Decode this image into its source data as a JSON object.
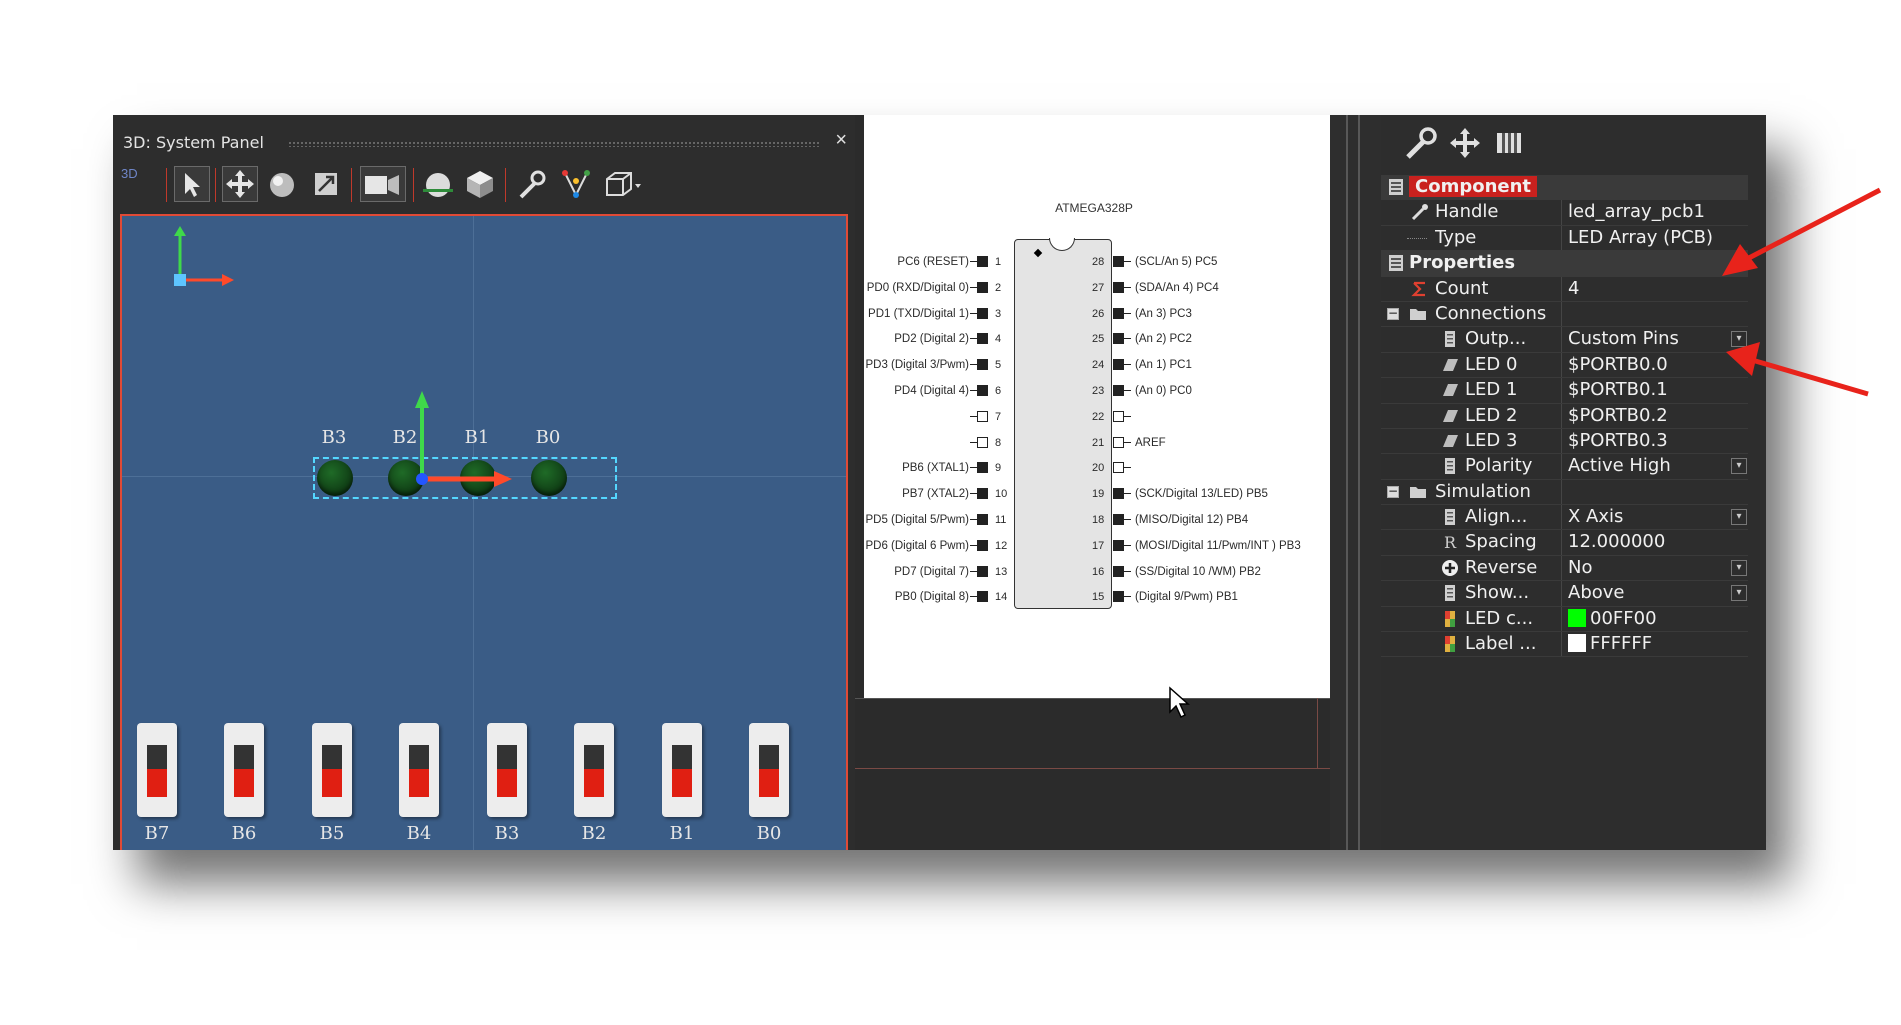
{
  "system_panel": {
    "title": "3D: System Panel",
    "close": "×",
    "toolbar": {
      "mode_label": "3D",
      "icons": [
        "pointer-icon",
        "move-icon",
        "sphere-icon",
        "resize-icon",
        "camera-icon",
        "light-sphere-icon",
        "cube-icon",
        "wrench-icon",
        "network-icon",
        "box-icon"
      ]
    },
    "led_labels": [
      "B3",
      "B2",
      "B1",
      "B0"
    ],
    "switch_labels": [
      "B7",
      "B6",
      "B5",
      "B4",
      "B3",
      "B2",
      "B1",
      "B0"
    ],
    "colors": {
      "viewport": "#3a5c86",
      "led": "#1f6b27",
      "switch_knob": "#e01f12"
    }
  },
  "schematic": {
    "chip_name": "ATMEGA328P",
    "left_pins": [
      {
        "num": "1",
        "label": "PC6 (RESET)"
      },
      {
        "num": "2",
        "label": "PD0 (RXD/Digital 0)"
      },
      {
        "num": "3",
        "label": "PD1 (TXD/Digital 1)"
      },
      {
        "num": "4",
        "label": "PD2 (Digital 2)"
      },
      {
        "num": "5",
        "label": "PD3 (Digital 3/Pwm)"
      },
      {
        "num": "6",
        "label": "PD4 (Digital 4)"
      },
      {
        "num": "7",
        "label": ""
      },
      {
        "num": "8",
        "label": ""
      },
      {
        "num": "9",
        "label": "PB6 (XTAL1)"
      },
      {
        "num": "10",
        "label": "PB7 (XTAL2)"
      },
      {
        "num": "11",
        "label": "PD5 (Digital 5/Pwm)"
      },
      {
        "num": "12",
        "label": "PD6 (Digital 6 Pwm)"
      },
      {
        "num": "13",
        "label": "PD7 (Digital 7)"
      },
      {
        "num": "14",
        "label": "PB0 (Digital 8)"
      }
    ],
    "right_pins": [
      {
        "num": "28",
        "label": "(SCL/An 5) PC5"
      },
      {
        "num": "27",
        "label": "(SDA/An 4) PC4"
      },
      {
        "num": "26",
        "label": "(An 3) PC3"
      },
      {
        "num": "25",
        "label": "(An 2) PC2"
      },
      {
        "num": "24",
        "label": "(An 1) PC1"
      },
      {
        "num": "23",
        "label": "(An 0) PC0"
      },
      {
        "num": "22",
        "label": ""
      },
      {
        "num": "21",
        "label": "AREF"
      },
      {
        "num": "20",
        "label": ""
      },
      {
        "num": "19",
        "label": "(SCK/Digital 13/LED) PB5"
      },
      {
        "num": "18",
        "label": "(MISO/Digital 12) PB4"
      },
      {
        "num": "17",
        "label": "(MOSI/Digital 11/Pwm/INT ) PB3"
      },
      {
        "num": "16",
        "label": "(SS/Digital 10 /WM) PB2"
      },
      {
        "num": "15",
        "label": "(Digital 9/Pwm) PB1"
      }
    ]
  },
  "properties": {
    "toolbar_icons": [
      "wrench-icon",
      "move-icon",
      "chip-icon"
    ],
    "rows": [
      {
        "kind": "section-main",
        "name": "Component",
        "icon": "component-icon"
      },
      {
        "kind": "prop",
        "name": "Handle",
        "value": "led_array_pcb1",
        "icon": "pen-icon",
        "indent": 1
      },
      {
        "kind": "prop",
        "name": "Type",
        "value": "LED Array (PCB)",
        "icon": "",
        "indent": 1
      },
      {
        "kind": "section",
        "name": "Properties",
        "icon": "properties-icon"
      },
      {
        "kind": "prop",
        "name": "Count",
        "value": "4",
        "icon": "sigma-icon",
        "indent": 1
      },
      {
        "kind": "group",
        "name": "Connections",
        "icon": "folder-icon"
      },
      {
        "kind": "prop",
        "name": "Outp...",
        "value": "Custom Pins",
        "icon": "doc-icon",
        "indent": 2,
        "dropdown": true
      },
      {
        "kind": "prop",
        "name": "LED 0",
        "value": "$PORTB0.0",
        "icon": "pin-icon",
        "indent": 2
      },
      {
        "kind": "prop",
        "name": "LED 1",
        "value": "$PORTB0.1",
        "icon": "pin-icon",
        "indent": 2
      },
      {
        "kind": "prop",
        "name": "LED 2",
        "value": "$PORTB0.2",
        "icon": "pin-icon",
        "indent": 2
      },
      {
        "kind": "prop",
        "name": "LED 3",
        "value": "$PORTB0.3",
        "icon": "pin-icon",
        "indent": 2
      },
      {
        "kind": "prop",
        "name": "Polarity",
        "value": "Active High",
        "icon": "doc-icon",
        "indent": 2,
        "dropdown": true
      },
      {
        "kind": "group",
        "name": "Simulation",
        "icon": "folder-icon"
      },
      {
        "kind": "prop",
        "name": "Align...",
        "value": "X Axis",
        "icon": "doc-icon",
        "indent": 2,
        "dropdown": true
      },
      {
        "kind": "prop",
        "name": "Spacing",
        "value": "12.000000",
        "icon": "r-icon",
        "indent": 2
      },
      {
        "kind": "prop",
        "name": "Reverse",
        "value": "No",
        "icon": "plus-circle-icon",
        "indent": 2,
        "dropdown": true
      },
      {
        "kind": "prop",
        "name": "Show...",
        "value": "Above",
        "icon": "doc-icon",
        "indent": 2,
        "dropdown": true
      },
      {
        "kind": "prop",
        "name": "LED c...",
        "value": "00FF00",
        "icon": "color-icon",
        "indent": 2,
        "swatch": "#00ff00"
      },
      {
        "kind": "prop",
        "name": "Label ...",
        "value": "FFFFFF",
        "icon": "color-icon",
        "indent": 2,
        "swatch": "#ffffff"
      }
    ]
  },
  "annotations": {
    "arrow_color": "#e8231b"
  }
}
